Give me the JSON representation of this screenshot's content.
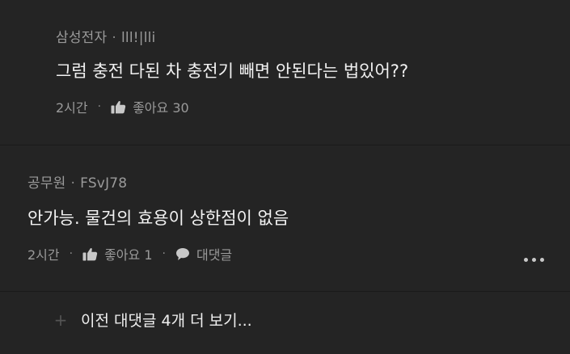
{
  "comments": [
    {
      "category": "삼성전자",
      "separator": "·",
      "author": "lll!|lli",
      "text": "그럼 충전 다된 차 충전기 빼면 안된다는 법있어??",
      "time": "2시간",
      "dot": "·",
      "likes_label": "좋아요 30"
    },
    {
      "category": "공무원",
      "separator": "·",
      "author": "FSvJ78",
      "text": "안가능. 물건의 효용이 상한점이 없음",
      "time": "2시간",
      "dot": "·",
      "likes_label": "좋아요 1",
      "reply_label": "대댓글"
    }
  ],
  "icons": {
    "like": "thumbs-up-icon",
    "reply": "speech-bubble-icon",
    "more": "more-dots-icon",
    "expand": "plus-icon"
  },
  "load_more": {
    "plus": "+",
    "label": "이전 대댓글 4개 더 보기..."
  },
  "colors": {
    "background": "#242424",
    "divider": "#1a1a1a",
    "meta_text": "#9a9a9a",
    "body_text": "#f2f2f2"
  }
}
